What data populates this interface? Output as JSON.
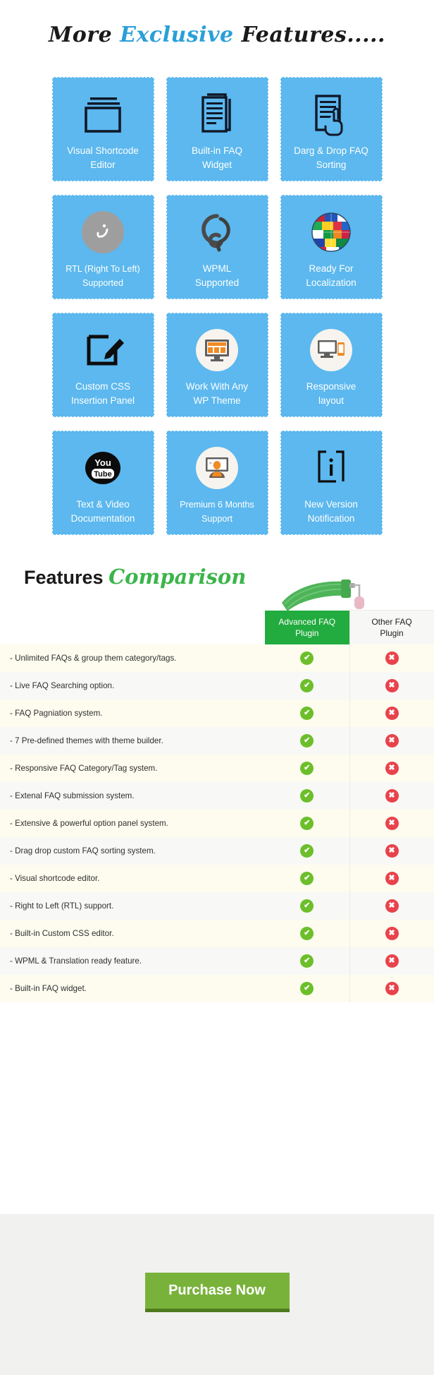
{
  "headings": {
    "exclusive_pre": "More ",
    "exclusive_accent": "Exclusive",
    "exclusive_post": " Features.....",
    "comparison_pre": "Features ",
    "comparison_accent": "Comparison"
  },
  "colors": {
    "tile_bg": "#5cb8ee",
    "heading_accent_blue": "#2a9fd8",
    "heading_accent_green": "#3bb54a",
    "table_header_green": "#22ab3e",
    "check_green": "#6cbf2a",
    "cross_red": "#e8434c",
    "cta_green": "#79b23b",
    "cta_shadow_green": "#4e7a1d"
  },
  "features": [
    {
      "label": "Visual Shortcode\nEditor",
      "icon": "window-frame-icon"
    },
    {
      "label": "Built-in FAQ\nWidget",
      "icon": "document-stack-icon"
    },
    {
      "label": "Darg & Drop FAQ\nSorting",
      "icon": "document-hand-drag-icon"
    },
    {
      "label": "RTL  (Right To Left)\nSupported",
      "icon": "rtl-arabic-letter-icon"
    },
    {
      "label": "WPML\nSupported",
      "icon": "wpml-logo-icon"
    },
    {
      "label": "Ready For\nLocalization",
      "icon": "flag-globe-icon"
    },
    {
      "label": "Custom CSS\nInsertion Panel",
      "icon": "pencil-edit-square-icon"
    },
    {
      "label": "Work With Any\nWP Theme",
      "icon": "desktop-monitor-icon"
    },
    {
      "label": "Responsive\nlayout",
      "icon": "devices-responsive-icon"
    },
    {
      "label": "Text & Video\nDocumentation",
      "icon": "youtube-icon"
    },
    {
      "label": "Premium 6 Months\nSupport",
      "icon": "support-agent-icon"
    },
    {
      "label": "New Version\nNotification",
      "icon": "info-bracket-icon"
    }
  ],
  "comparison_table": {
    "columns": [
      "",
      "Advanced FAQ\nPlugin",
      "Other FAQ\nPlugin"
    ],
    "check_glyph": "✔",
    "cross_glyph": "✖",
    "rows": [
      {
        "feature": "- Unlimited FAQs & group them category/tags.",
        "advanced": "yes",
        "other": "no"
      },
      {
        "feature": "- Live FAQ Searching option.",
        "advanced": "yes",
        "other": "no"
      },
      {
        "feature": "- FAQ Pagniation system.",
        "advanced": "yes",
        "other": "no"
      },
      {
        "feature": "- 7 Pre-defined themes with theme builder.",
        "advanced": "yes",
        "other": "no"
      },
      {
        "feature": "- Responsive FAQ Category/Tag system.",
        "advanced": "yes",
        "other": "no"
      },
      {
        "feature": "- Extenal FAQ submission system.",
        "advanced": "yes",
        "other": "no"
      },
      {
        "feature": "- Extensive & powerful option panel system.",
        "advanced": "yes",
        "other": "no"
      },
      {
        "feature": "- Drag drop custom FAQ sorting system.",
        "advanced": "yes",
        "other": "no"
      },
      {
        "feature": "- Visual shortcode editor.",
        "advanced": "yes",
        "other": "no"
      },
      {
        "feature": "- Right to Left (RTL) support.",
        "advanced": "yes",
        "other": "no"
      },
      {
        "feature": "- Built-in Custom CSS editor.",
        "advanced": "yes",
        "other": "no"
      },
      {
        "feature": "- WPML & Translation ready feature.",
        "advanced": "yes",
        "other": "no"
      },
      {
        "feature": "- Built-in FAQ widget.",
        "advanced": "yes",
        "other": "no"
      }
    ]
  },
  "cta": {
    "label": "Purchase Now"
  }
}
